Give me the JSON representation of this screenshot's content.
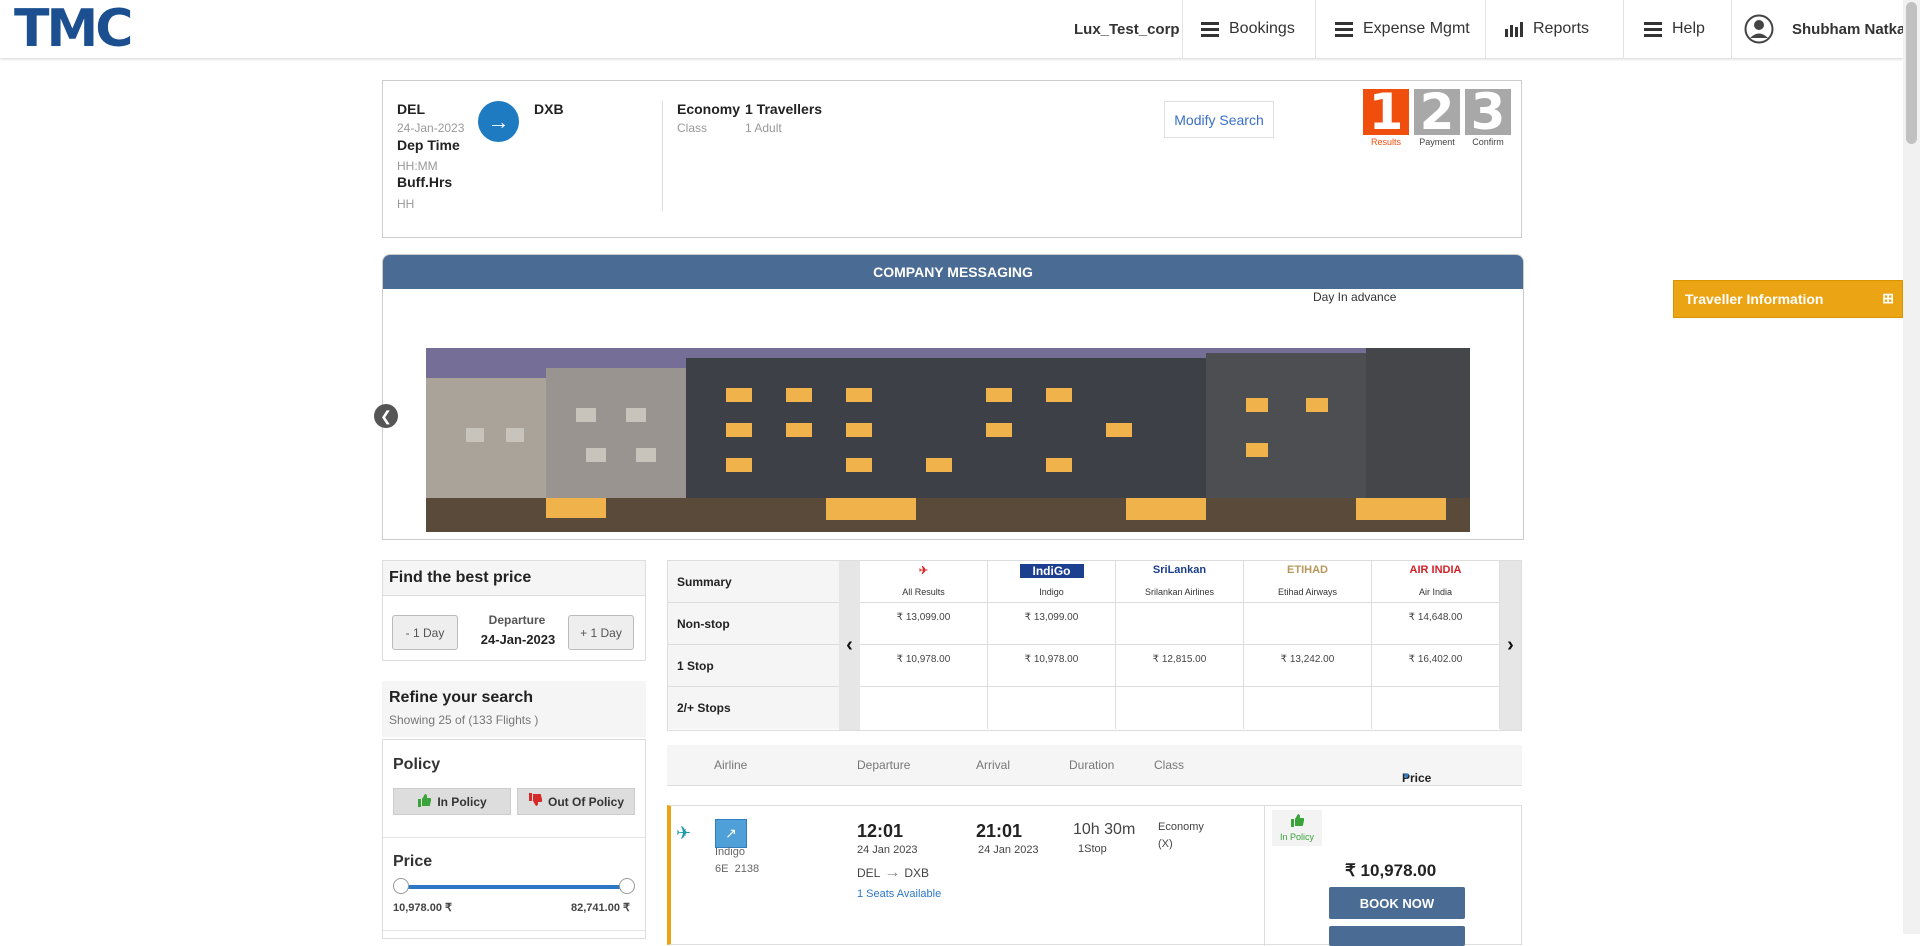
{
  "header": {
    "logo": "TMC",
    "company": "Lux_Test_corp",
    "nav": [
      "Bookings",
      "Expense Mgmt",
      "Reports",
      "Help"
    ],
    "user": "Shubham Natkar"
  },
  "search": {
    "from": "DEL",
    "to": "DXB",
    "date": "24-Jan-2023",
    "dep_time_label": "Dep Time",
    "dep_time_placeholder": "HH:MM",
    "buff_label": "Buff.Hrs",
    "buff_placeholder": "HH",
    "class_value": "Economy",
    "class_label": "Class",
    "travellers_value": "1 Travellers",
    "travellers_detail": "1 Adult",
    "modify_label": "Modify Search",
    "steps": [
      {
        "num": "1",
        "label": "Results",
        "color": "#f04e0c"
      },
      {
        "num": "2",
        "label": "Payment",
        "color": "#a8a8a8"
      },
      {
        "num": "3",
        "label": "Confirm",
        "color": "#a8a8a8"
      }
    ]
  },
  "messaging": {
    "title": "COMPANY MESSAGING",
    "note": "Day In advance"
  },
  "traveller_info": {
    "label": "Traveller Information",
    "toggle": "⊞"
  },
  "best_price": {
    "title": "Find the best price",
    "minus_label": "- 1 Day",
    "plus_label": "+ 1 Day",
    "departure_label": "Departure",
    "departure_date": "24-Jan-2023"
  },
  "refine": {
    "title": "Refine your search",
    "showing": "Showing 25 of (133 Flights )",
    "policy_title": "Policy",
    "in_policy": "In Policy",
    "out_policy": "Out Of Policy",
    "price_title": "Price",
    "price_min": "10,978.00 ₹",
    "price_max": "82,741.00 ₹"
  },
  "matrix": {
    "summary_label": "Summary",
    "rows": [
      "Non-stop",
      "1 Stop",
      "2/+ Stops"
    ],
    "airlines": [
      {
        "name": "All Results",
        "logo": "✈",
        "logo_color": "#d32f2f"
      },
      {
        "name": "Indigo",
        "logo": "IndiGo",
        "logo_color": "#1d3f8f"
      },
      {
        "name": "Srilankan Airlines",
        "logo": "SriLankan",
        "logo_color": "#1a3d8c"
      },
      {
        "name": "Etihad Airways",
        "logo": "ETIHAD",
        "logo_color": "#b8985a"
      },
      {
        "name": "Air India",
        "logo": "AIR INDIA",
        "logo_color": "#d12027"
      }
    ],
    "values": [
      [
        "₹ 13,099.00",
        "₹ 13,099.00",
        "",
        "",
        "₹ 14,648.00"
      ],
      [
        "₹ 10,978.00",
        "₹ 10,978.00",
        "₹ 12,815.00",
        "₹ 13,242.00",
        "₹ 16,402.00"
      ],
      [
        "",
        "",
        "",
        "",
        ""
      ]
    ],
    "prev": "‹",
    "next": "›"
  },
  "results_header": {
    "airline": "Airline",
    "departure": "Departure",
    "arrival": "Arrival",
    "duration": "Duration",
    "class": "Class",
    "price": "Price"
  },
  "flight": {
    "airline": "Indigo",
    "code": "6E",
    "number": "2138",
    "dep_time": "12:01",
    "dep_date": "24 Jan 2023",
    "arr_time": "21:01",
    "arr_date": "24 Jan 2023",
    "route_from": "DEL",
    "route_to": "DXB",
    "seats": "1 Seats Available",
    "duration": "10h 30m",
    "stops": "1Stop",
    "class": "Economy",
    "class_code": "(X)",
    "policy": "In Policy",
    "price": "₹ 10,978.00",
    "book_label": "BOOK NOW"
  }
}
